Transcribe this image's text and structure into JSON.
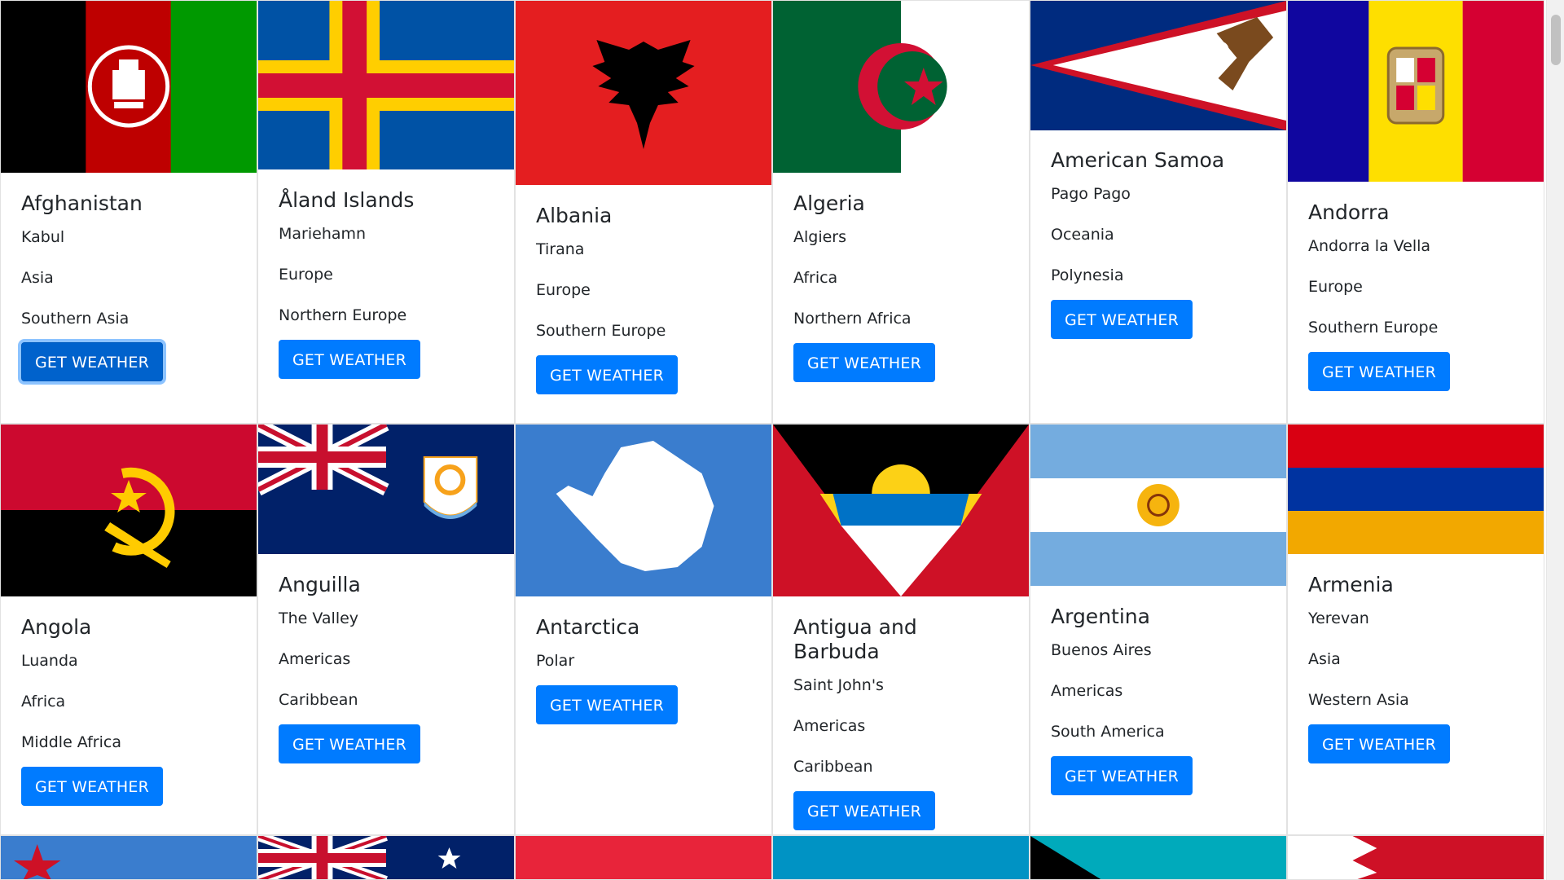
{
  "button_label": "GET WEATHER",
  "countries": [
    {
      "name": "Afghanistan",
      "lines": [
        "Kabul",
        "Asia",
        "Southern Asia"
      ]
    },
    {
      "name": "Åland Islands",
      "lines": [
        "Mariehamn",
        "Europe",
        "Northern Europe"
      ]
    },
    {
      "name": "Albania",
      "lines": [
        "Tirana",
        "Europe",
        "Southern Europe"
      ]
    },
    {
      "name": "Algeria",
      "lines": [
        "Algiers",
        "Africa",
        "Northern Africa"
      ]
    },
    {
      "name": "American Samoa",
      "lines": [
        "Pago Pago",
        "Oceania",
        "Polynesia"
      ]
    },
    {
      "name": "Andorra",
      "lines": [
        "Andorra la Vella",
        "Europe",
        "Southern Europe"
      ]
    },
    {
      "name": "Angola",
      "lines": [
        "Luanda",
        "Africa",
        "Middle Africa"
      ]
    },
    {
      "name": "Anguilla",
      "lines": [
        "The Valley",
        "Americas",
        "Caribbean"
      ]
    },
    {
      "name": "Antarctica",
      "lines": [
        "Polar"
      ]
    },
    {
      "name": "Antigua and Barbuda",
      "lines": [
        "Saint John's",
        "Americas",
        "Caribbean"
      ]
    },
    {
      "name": "Argentina",
      "lines": [
        "Buenos Aires",
        "Americas",
        "South America"
      ]
    },
    {
      "name": "Armenia",
      "lines": [
        "Yerevan",
        "Asia",
        "Western Asia"
      ]
    }
  ],
  "colors": {
    "button_blue": "#007bff"
  }
}
